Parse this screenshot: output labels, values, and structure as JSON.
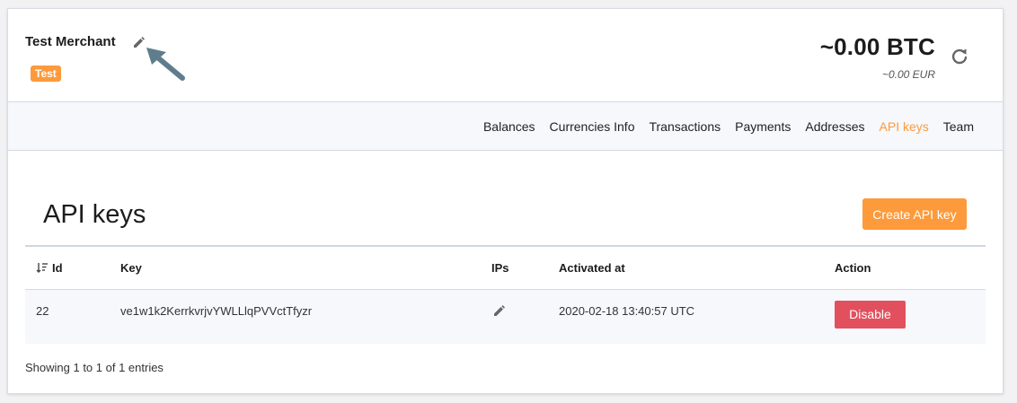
{
  "merchant": {
    "name": "Test Merchant",
    "badge": "Test"
  },
  "balance": {
    "btc": "~0.00 BTC",
    "eur": "~0.00 EUR"
  },
  "nav": {
    "items": [
      {
        "label": "Balances",
        "active": false
      },
      {
        "label": "Currencies Info",
        "active": false
      },
      {
        "label": "Transactions",
        "active": false
      },
      {
        "label": "Payments",
        "active": false
      },
      {
        "label": "Addresses",
        "active": false
      },
      {
        "label": "API keys",
        "active": true
      },
      {
        "label": "Team",
        "active": false
      }
    ]
  },
  "page": {
    "title": "API keys",
    "create_button": "Create API key"
  },
  "table": {
    "headers": [
      "Id",
      "Key",
      "IPs",
      "Activated at",
      "Action"
    ],
    "rows": [
      {
        "id": "22",
        "key": "ve1w1k2KerrkvrjvYWLLlqPVVctTfyzr",
        "ips": "",
        "activated_at": "2020-02-18 13:40:57 UTC",
        "action": "Disable"
      }
    ],
    "info": "Showing 1 to 1 of 1 entries"
  },
  "icons": {
    "edit_merchant": "pencil-icon",
    "annotation": "arrow-icon",
    "refresh": "refresh-icon",
    "sort": "sort-descending-icon",
    "edit_ips": "pencil-icon"
  },
  "colors": {
    "accent": "#fd9a3b",
    "danger": "#e2505e",
    "nav_bg": "#f6f8fc",
    "annotation_arrow": "#5f7d8c"
  }
}
